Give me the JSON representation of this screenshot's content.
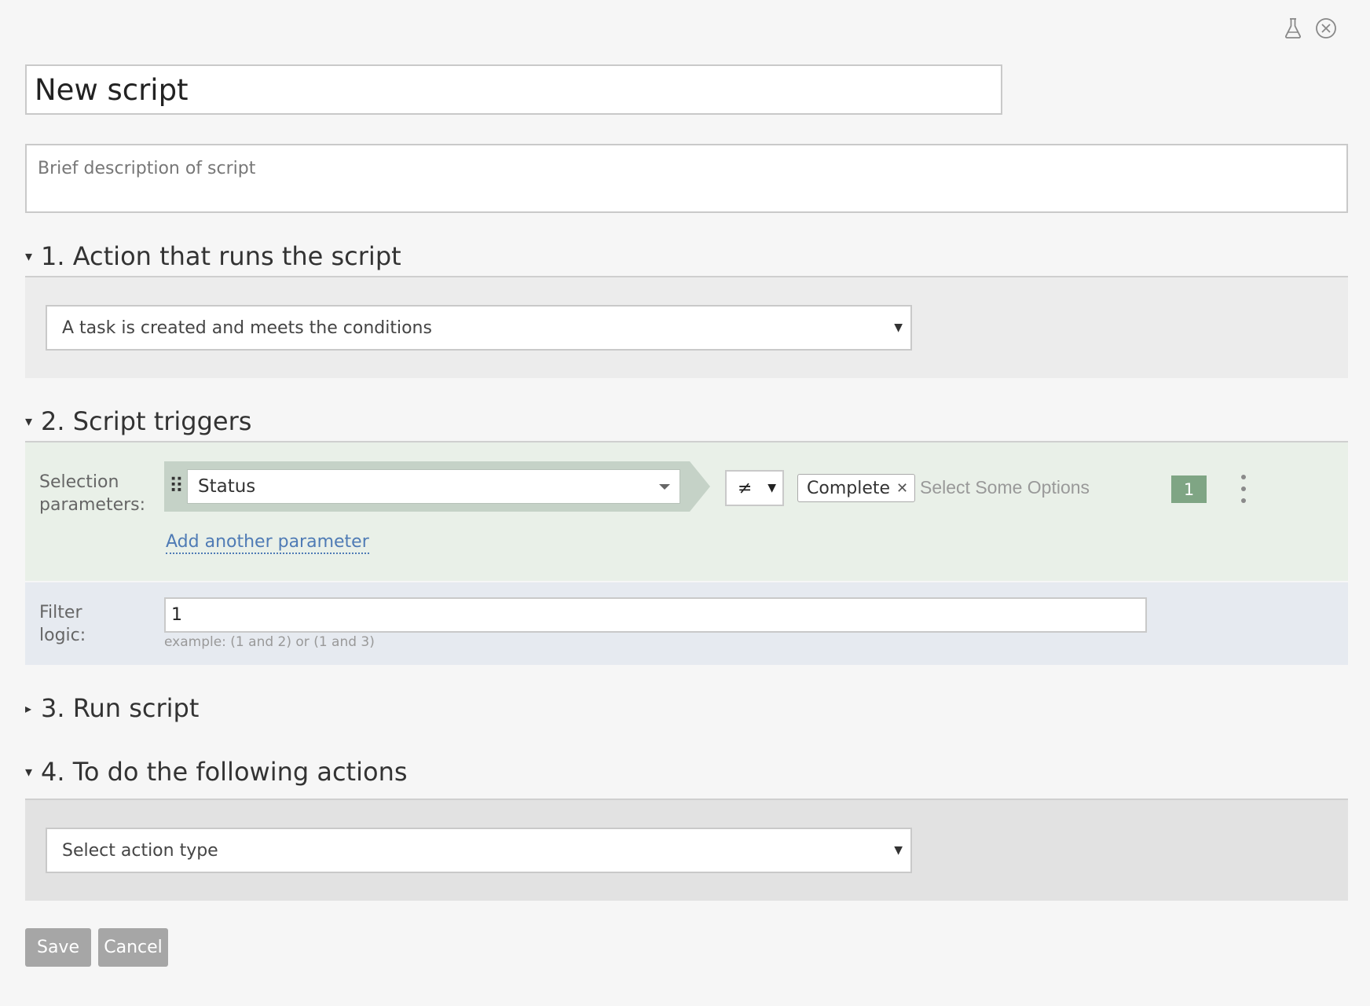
{
  "header": {
    "title_value": "New script",
    "description_placeholder": "Brief description of script",
    "icons": [
      "flask-icon",
      "close-circle-icon"
    ]
  },
  "sections": {
    "action": {
      "heading": "1. Action that runs the script",
      "expanded": true,
      "selected": "A task is created and meets the conditions"
    },
    "triggers": {
      "heading": "2. Script triggers",
      "expanded": true,
      "selection_label": "Selection\nparameters:",
      "parameter_field": "Status",
      "operator": "≠",
      "chip_value": "Complete",
      "options_placeholder": "Select Some Options",
      "parameter_number": "1",
      "add_link": "Add another parameter",
      "filter_label": "Filter\nlogic:",
      "filter_value": "1",
      "filter_hint": "example: (1 and 2) or (1 and 3)"
    },
    "run": {
      "heading": "3. Run script",
      "expanded": false
    },
    "actions": {
      "heading": "4. To do the following actions",
      "expanded": true,
      "selected": "Select action type"
    }
  },
  "buttons": {
    "save": "Save",
    "cancel": "Cancel"
  },
  "colors": {
    "triggers_bg": "#e9f0e8",
    "filter_bg": "#e6eaf0",
    "badge": "#7fa584",
    "link": "#4f7bb5"
  }
}
